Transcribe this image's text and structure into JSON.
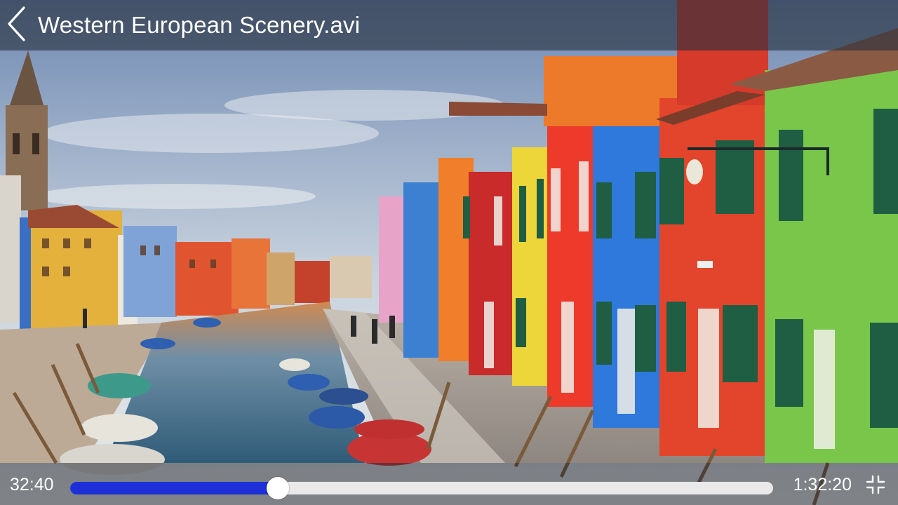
{
  "header": {
    "title": "Western European Scenery.avi",
    "back_icon": "chevron-left-icon"
  },
  "controls": {
    "elapsed": "32:40",
    "duration": "1:32:20",
    "progress": 0.295,
    "fullscreen_icon": "fullscreen-exit-icon",
    "accent_color": "#1f2fd8"
  },
  "scene": {
    "description_hidden": true
  }
}
